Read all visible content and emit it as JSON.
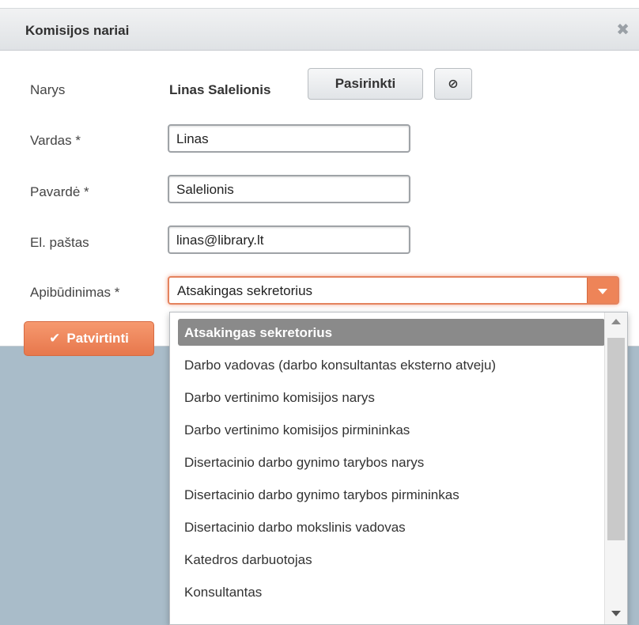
{
  "dialog": {
    "title": "Komisijos nariai",
    "close_icon": "close-icon"
  },
  "form": {
    "member_label": "Narys",
    "member_value": "Linas Salelionis",
    "choose_button": "Pasirinkti",
    "clear_icon": "⊘",
    "first_name_label": "Vardas *",
    "first_name_value": "Linas",
    "last_name_label": "Pavardė *",
    "last_name_value": "Salelionis",
    "email_label": "El. paštas",
    "email_value": "linas@library.lt",
    "role_label": "Apibūdinimas *",
    "role_value": "Atsakingas sekretorius",
    "confirm_button": "Patvirtinti",
    "confirm_icon": "✔"
  },
  "dropdown": {
    "options": [
      "Atsakingas sekretorius",
      "Darbo vadovas (darbo konsultantas eksterno atveju)",
      "Darbo vertinimo komisijos narys",
      "Darbo vertinimo komisijos pirmininkas",
      "Disertacinio darbo gynimo tarybos narys",
      "Disertacinio darbo gynimo tarybos pirmininkas",
      "Disertacinio darbo mokslinis vadovas",
      "Katedros darbuotojas",
      "Konsultantas"
    ],
    "selected_index": 0
  },
  "colors": {
    "accent": "#ee8458",
    "selected_option_bg": "#8a8a8a",
    "backdrop": "#a9bcc9"
  }
}
